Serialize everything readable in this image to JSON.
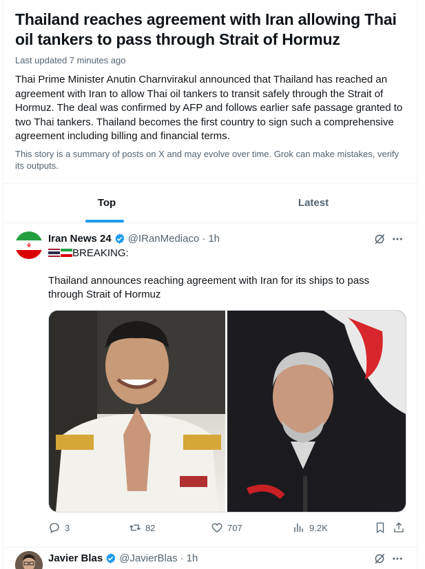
{
  "story": {
    "headline": "Thailand reaches agreement with Iran allowing Thai oil tankers to pass through Strait of Hormuz",
    "updated": "Last updated 7 minutes ago",
    "summary": "Thai Prime Minister Anutin Charnvirakul announced that Thailand has reached an agreement with Iran to allow Thai oil tankers to transit safely through the Strait of Hormuz. The deal was confirmed by AFP and follows earlier safe passage granted to two Thai tankers. Thailand becomes the first country to sign such a comprehensive agreement including billing and financial terms.",
    "disclaimer": "This story is a summary of posts on X and may evolve over time. Grok can make mistakes, verify its outputs."
  },
  "tabs": [
    {
      "label": "Top",
      "active": true
    },
    {
      "label": "Latest",
      "active": false
    }
  ],
  "posts": [
    {
      "name": "Iran News 24",
      "handle": "@IRanMediaco",
      "time": "1h",
      "line1": "BREAKING:",
      "line2": "Thailand announces reaching agreement with Iran for its ships to pass through Strait of Hormuz",
      "stats": {
        "replies": "3",
        "reposts": "82",
        "likes": "707",
        "views": "9.2K"
      }
    },
    {
      "name": "Javier Blas",
      "handle": "@JavierBlas",
      "time": "1h"
    }
  ],
  "colors": {
    "accent": "#1d9bf0",
    "verified": "#1d9bf0",
    "muted": "#536471",
    "border": "#eff3f4"
  },
  "icons": [
    "verified-badge-icon",
    "grok-icon",
    "more-icon",
    "reply-icon",
    "repost-icon",
    "like-icon",
    "views-icon",
    "bookmark-icon",
    "share-icon"
  ]
}
